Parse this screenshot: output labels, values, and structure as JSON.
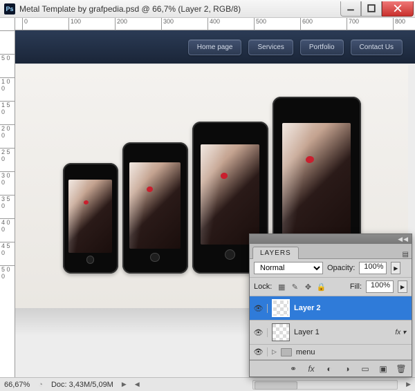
{
  "window": {
    "app_icon_text": "Ps",
    "title": "Metal Template by grafpedia.psd @ 66,7% (Layer 2, RGB/8)"
  },
  "rulers": {
    "h_ticks": [
      "0",
      "100",
      "200",
      "300",
      "400",
      "500",
      "600",
      "700",
      "800"
    ],
    "v_ticks": [
      "",
      "5 0",
      "1 0 0",
      "1 5 0",
      "2 0 0",
      "2 5 0",
      "3 0 0",
      "3 5 0",
      "4 0 0",
      "4 5 0",
      "5 0 0"
    ]
  },
  "nav": {
    "items": [
      "Home page",
      "Services",
      "Portfolio",
      "Contact Us"
    ]
  },
  "status": {
    "zoom": "66,67%",
    "doc": "Doc: 3,43M/5,09M"
  },
  "layers_panel": {
    "title": "LAYERS",
    "blend_mode": "Normal",
    "opacity_label": "Opacity:",
    "opacity_value": "100%",
    "lock_label": "Lock:",
    "fill_label": "Fill:",
    "fill_value": "100%",
    "layers": [
      {
        "name": "Layer 2",
        "selected": true,
        "fx": false
      },
      {
        "name": "Layer 1",
        "selected": false,
        "fx": true
      }
    ],
    "group": {
      "name": "menu"
    }
  }
}
